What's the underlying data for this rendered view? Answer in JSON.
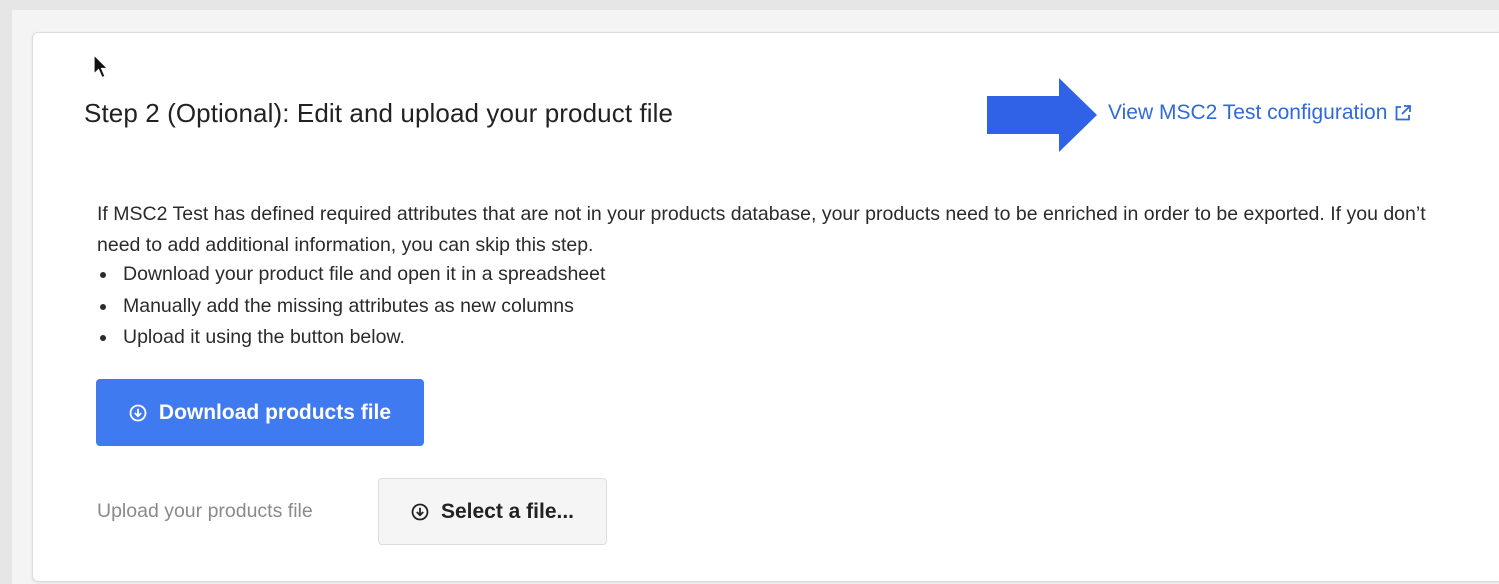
{
  "step": {
    "title": "Step 2 (Optional): Edit and upload your product file",
    "config_link_label": "View MSC2 Test configuration",
    "description": "If MSC2 Test has defined required attributes that are not in your products database, your products need to be enriched in order to be exported. If you don’t need to add additional information, you can skip this step.",
    "instructions": [
      "Download your product file and open it in a spreadsheet",
      "Manually add the missing attributes as new columns",
      "Upload it using the button below."
    ],
    "download_button_label": "Download products file",
    "upload_label": "Upload your products file",
    "select_file_button_label": "Select a file..."
  },
  "icons": {
    "cursor": "mouse-pointer-icon",
    "annotation_arrow": "arrow-right-icon",
    "external_link": "external-link-icon",
    "download": "download-circle-icon",
    "upload": "upload-circle-icon"
  },
  "colors": {
    "link": "#2f6ad8",
    "primary_button": "#3f7af0",
    "annotation_arrow": "#2f62e6"
  }
}
